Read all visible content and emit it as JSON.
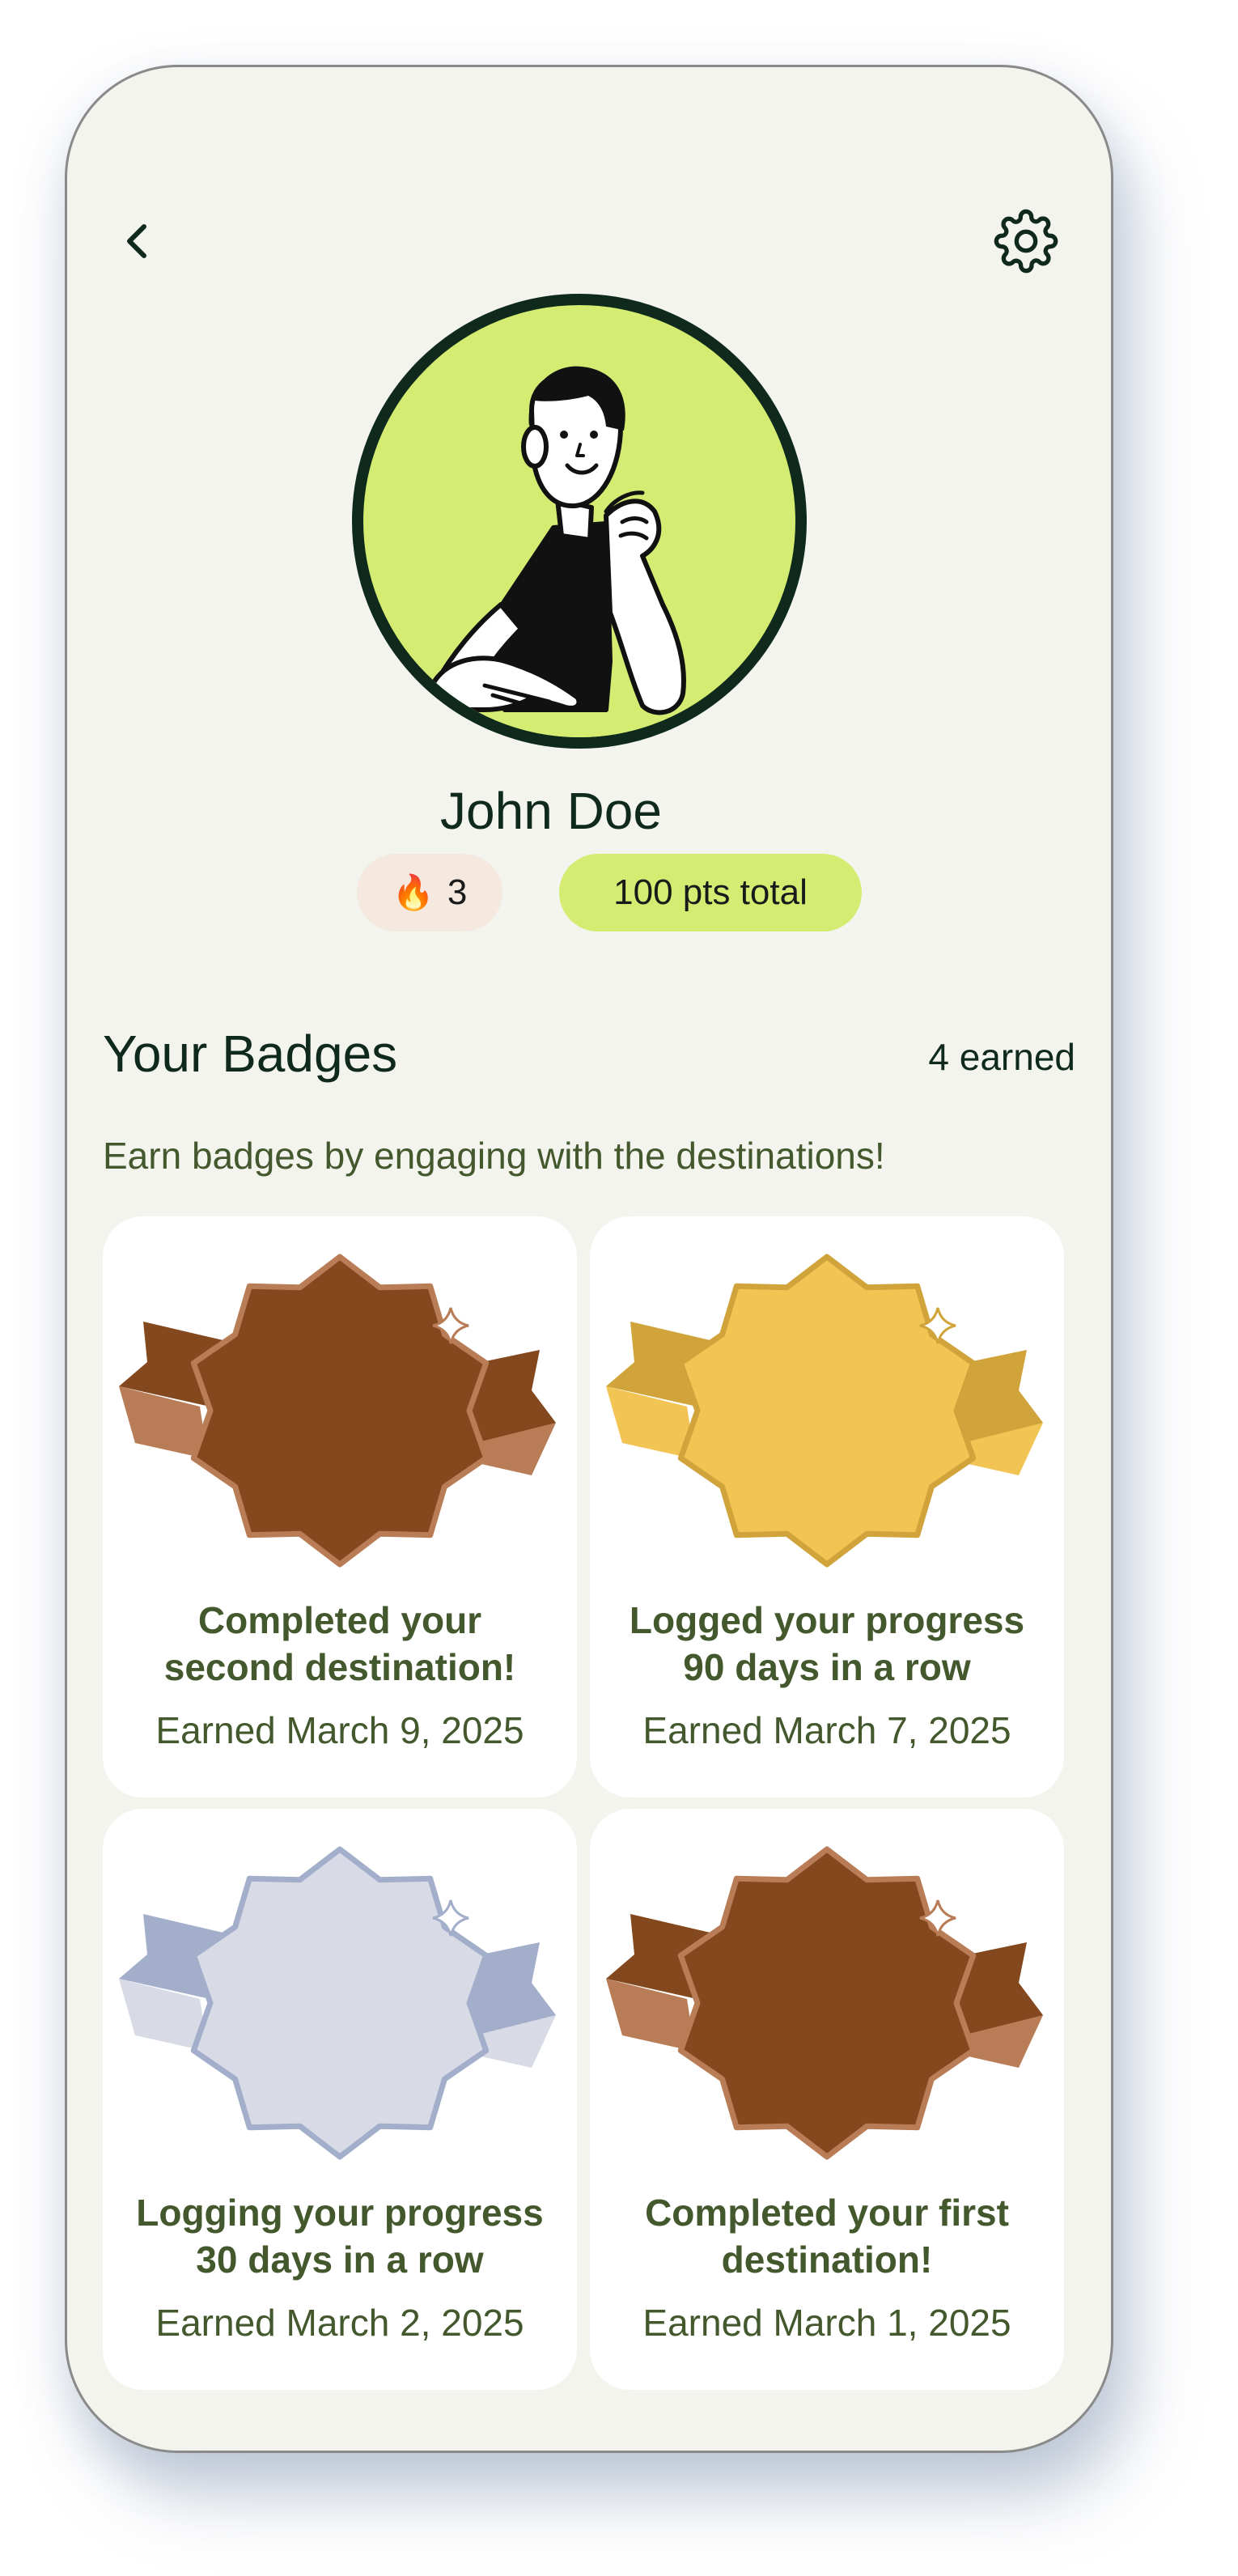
{
  "profile": {
    "name": "John Doe",
    "streak_count": "3",
    "streak_icon": "fire-emoji",
    "points_label": "100 pts total",
    "avatar_icon": "person-illustration"
  },
  "header": {
    "back_icon": "chevron-left-icon",
    "settings_icon": "gear-icon"
  },
  "badges_section": {
    "title": "Your Badges",
    "earned_label": "4 earned",
    "subtitle": "Earn badges by engaging with the destinations!",
    "badges": [
      {
        "title_line1": "Completed your",
        "title_line2": "second destination!",
        "date": "Earned March 9, 2025",
        "tier": "bronze",
        "colors": {
          "face": "#84481e",
          "rim": "#b87d56",
          "ribbon_light": "#b87d56",
          "ribbon_dark": "#84481e"
        }
      },
      {
        "title_line1": "Logged your progress",
        "title_line2": "90 days in a row",
        "date": "Earned March 7, 2025",
        "tier": "gold",
        "colors": {
          "face": "#f1c454",
          "rim": "#d0a43a",
          "ribbon_light": "#f1c454",
          "ribbon_dark": "#d0a43a"
        }
      },
      {
        "title_line1": "Logging your progress",
        "title_line2": "30 days in a row",
        "date": "Earned March 2, 2025",
        "tier": "silver",
        "colors": {
          "face": "#d8dbe6",
          "rim": "#a3aecb",
          "ribbon_light": "#d8dbe6",
          "ribbon_dark": "#a3aecb"
        }
      },
      {
        "title_line1": "Completed your first",
        "title_line2": "destination!",
        "date": "Earned March 1, 2025",
        "tier": "bronze",
        "colors": {
          "face": "#84481e",
          "rim": "#b87d56",
          "ribbon_light": "#b87d56",
          "ribbon_dark": "#84481e"
        }
      }
    ]
  },
  "colors": {
    "background": "#f4f4ef",
    "accent_green": "#d4ec72",
    "dark_green": "#0f2a1c",
    "text_olive": "#44582d"
  }
}
